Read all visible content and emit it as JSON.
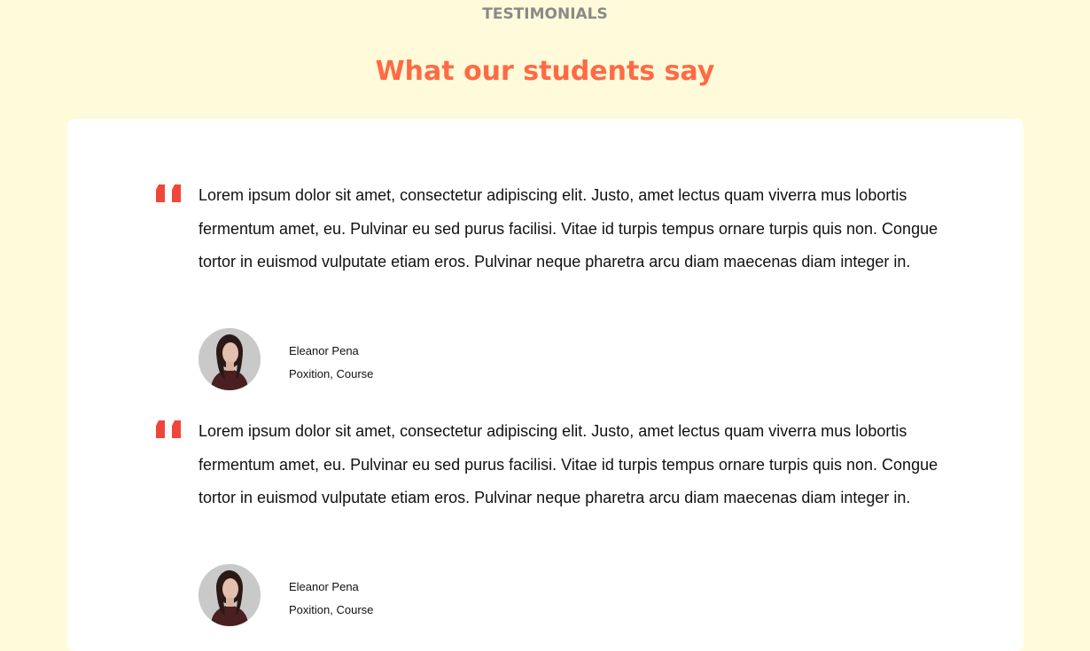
{
  "section": {
    "eyebrow": "TESTIMONIALS",
    "heading": "What our students say"
  },
  "colors": {
    "background": "#fffad9",
    "heading": "#ff6a45",
    "quote_icon": "#f0463a",
    "eyebrow": "#8a8a8a",
    "card": "#ffffff"
  },
  "testimonials": [
    {
      "quote_icon": "quote-icon",
      "text": "Lorem ipsum dolor sit amet, consectetur adipiscing elit. Justo, amet lectus quam viverra mus lobortis fermentum amet, eu. Pulvinar eu sed purus facilisi. Vitae id turpis tempus ornare turpis quis non. Congue tortor in euismod vulputate etiam eros. Pulvinar neque pharetra arcu diam maecenas diam integer in.",
      "name": "Eleanor Pena",
      "role": "Poxition, Course"
    },
    {
      "quote_icon": "quote-icon",
      "text": "Lorem ipsum dolor sit amet, consectetur adipiscing elit. Justo, amet lectus quam viverra mus lobortis fermentum amet, eu. Pulvinar eu sed purus facilisi. Vitae id turpis tempus ornare turpis quis non. Congue tortor in euismod vulputate etiam eros. Pulvinar neque pharetra arcu diam maecenas diam integer in.",
      "name": "Eleanor Pena",
      "role": "Poxition, Course"
    }
  ]
}
